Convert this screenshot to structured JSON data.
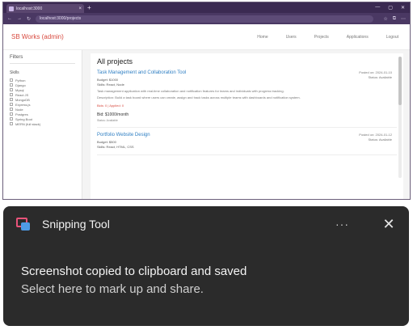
{
  "browser": {
    "tab_title": "localhost:3000",
    "tab_close": "×",
    "new_tab": "+",
    "url": "localhost:3000/projects",
    "nav": {
      "back": "←",
      "forward": "→",
      "reload": "↻"
    },
    "window": {
      "minimize": "—",
      "maximize": "▢",
      "close": "✕"
    },
    "tools": {
      "star": "☆",
      "extensions": "⧉",
      "menu": "⋯"
    }
  },
  "app": {
    "brand": "SB Works (admin)",
    "nav": [
      "Home",
      "Users",
      "Projects",
      "Applications",
      "Logout"
    ]
  },
  "sidebar": {
    "heading": "Filters",
    "skills_label": "Skills",
    "skills": [
      "Python",
      "Django",
      "Mysql",
      "React JS",
      "MongoDB",
      "Express.js",
      "Node",
      "Postgres",
      "Spring Boot",
      "MERN (full stack)"
    ]
  },
  "main": {
    "heading": "All projects",
    "projects": [
      {
        "title": "Task Management and Collaboration Tool",
        "date": "Posted on: 2024-01-10",
        "status": "Status: Available",
        "budget_line": "Budget: $1000",
        "skills_line": "Skills: React, Node",
        "desc1": "Task management application with real-time collaboration and notification features for teams and individuals with progress tracking.",
        "desc2": "Description: Build a task board where users can create, assign and track tasks across multiple teams with dashboards and notification system.",
        "link": "Bids: 0 | Applied: 0",
        "budget": "Bid: $1000/month",
        "budget_sub": "Status: Available"
      },
      {
        "title": "Portfolio Website Design",
        "date": "Posted on: 2024-01-12",
        "status": "Status: Available",
        "budget_line": "Budget: $500",
        "skills_line": "Skills: React, HTML, CSS",
        "desc1": "",
        "desc2": "",
        "link": "",
        "budget": "",
        "budget_sub": ""
      }
    ]
  },
  "toast": {
    "app_name": "Snipping Tool",
    "more": "···",
    "close": "✕",
    "line1": "Screenshot copied to clipboard and saved",
    "line2": "Select here to mark up and share."
  },
  "colors": {
    "brand": "#d84a3f",
    "link": "#2f7fc3",
    "toast_bg": "#2b2b2b",
    "browser_chrome": "#3b2a52"
  }
}
